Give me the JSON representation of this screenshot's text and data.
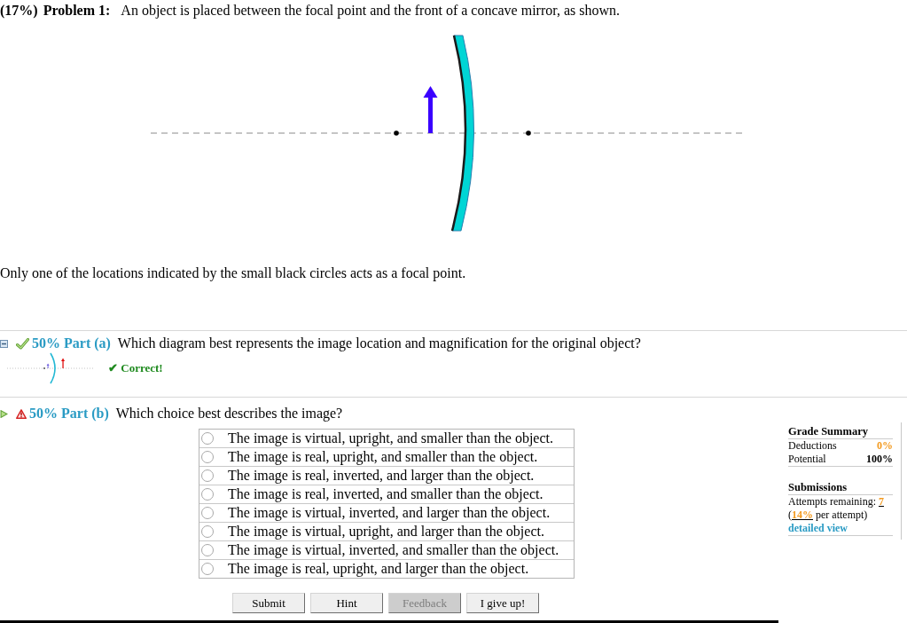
{
  "problem": {
    "weight": "(17%)",
    "label": "Problem 1:",
    "statement": "An object is placed between the focal point and the front of a concave mirror, as shown.",
    "note": "Only one of the locations indicated by the small black circles acts as a focal point."
  },
  "parts": [
    {
      "current": false,
      "correct": true,
      "heading": "50% Part (a)",
      "question": "Which diagram best represents the image location and magnification for the original object?",
      "feedback": "✔ Correct!"
    },
    {
      "current": true,
      "correct": false,
      "heading": "50% Part (b)",
      "question": "Which choice best describes the image?",
      "choices": [
        {
          "text": "The image is virtual, upright, and smaller than the object.",
          "selected": false
        },
        {
          "text": "The image is real, upright, and smaller than the object.",
          "selected": false
        },
        {
          "text": "The image is real, inverted, and larger than the object.",
          "selected": false
        },
        {
          "text": "The image is real, inverted, and smaller than the object.",
          "selected": false
        },
        {
          "text": "The image is virtual, inverted, and larger than the object.",
          "selected": false
        },
        {
          "text": "The image is virtual, upright, and larger than the object.",
          "selected": false
        },
        {
          "text": "The image is virtual, inverted, and smaller than the object.",
          "selected": false
        },
        {
          "text": "The image is real, upright, and larger than the object.",
          "selected": false
        }
      ],
      "buttons": [
        {
          "label": "Submit",
          "disabled": false
        },
        {
          "label": "Hint",
          "disabled": false
        },
        {
          "label": "Feedback",
          "disabled": true
        },
        {
          "label": "I give up!",
          "disabled": false
        }
      ],
      "grade_summary": {
        "title": "Grade Summary",
        "rows": [
          {
            "label": "Deductions",
            "value": "0%",
            "kind": "deduction"
          },
          {
            "label": "Potential",
            "value": "100%",
            "kind": "total"
          }
        ]
      },
      "submissions": {
        "title": "Submissions",
        "attempts_label": "Attempts remaining:",
        "attempts": "7",
        "share_open": "(",
        "share": "14%",
        "share_rest": "per attempt)",
        "link": "detailed view"
      }
    }
  ]
}
